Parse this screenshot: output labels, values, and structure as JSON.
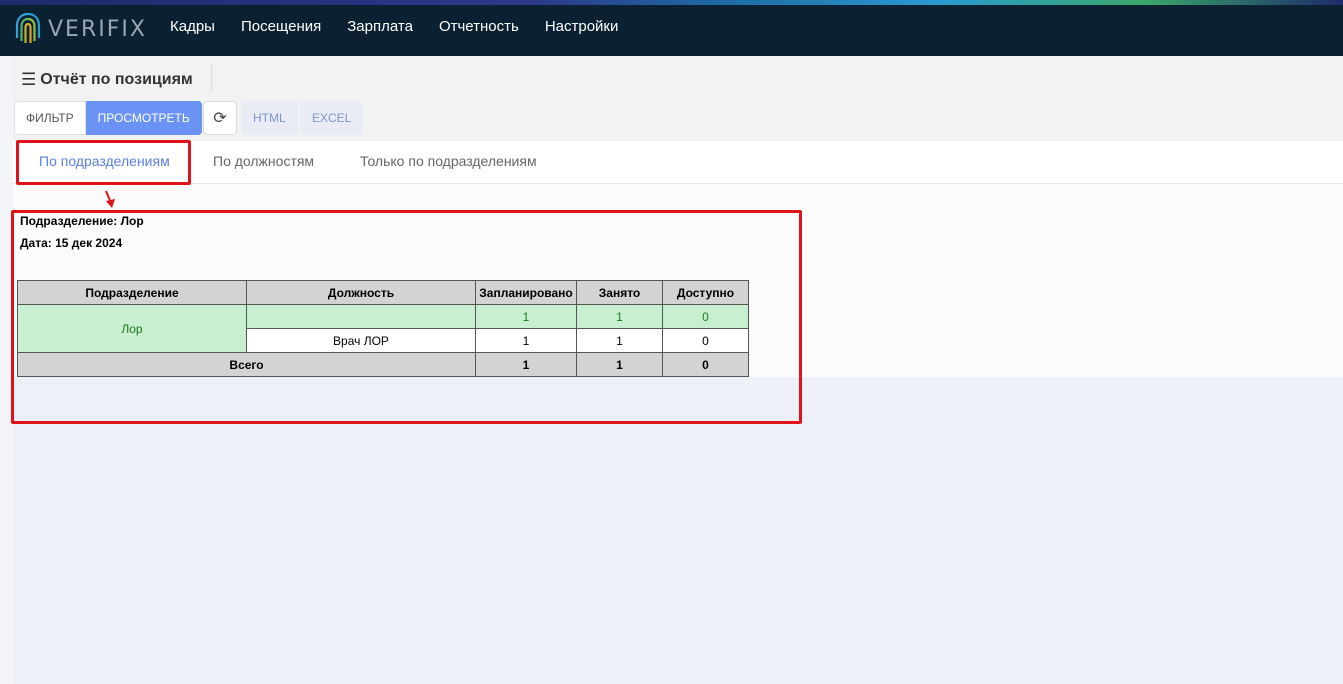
{
  "app": {
    "logo_text": "VERIFIX"
  },
  "nav": {
    "items": [
      "Кадры",
      "Посещения",
      "Зарплата",
      "Отчетность",
      "Настройки"
    ]
  },
  "page": {
    "title": "Отчёт по позициям"
  },
  "toolbar": {
    "filter_label": "ФИЛЬТР",
    "view_label": "ПРОСМОТРЕТЬ",
    "html_label": "HTML",
    "excel_label": "EXCEL"
  },
  "tabs": [
    {
      "label": "По подразделениям",
      "active": true
    },
    {
      "label": "По должностям",
      "active": false
    },
    {
      "label": "Только по подразделениям",
      "active": false
    }
  ],
  "report": {
    "department_line": "Подразделение: Лор",
    "date_line": "Дата: 15 дек 2024",
    "table": {
      "headers": [
        "Подразделение",
        "Должность",
        "Запланировано",
        "Занято",
        "Доступно"
      ],
      "group": {
        "department": "Лор",
        "summary": {
          "position": "",
          "planned": "1",
          "occupied": "1",
          "available": "0"
        },
        "rows": [
          {
            "position": "Врач ЛОР",
            "planned": "1",
            "occupied": "1",
            "available": "0"
          }
        ]
      },
      "total": {
        "label": "Всего",
        "planned": "1",
        "occupied": "1",
        "available": "0"
      }
    }
  },
  "colors": {
    "accent": "#6a93f5",
    "nav_bg": "#0b2030",
    "highlight_green": "#c8efd0",
    "annotation": "#e0131b"
  }
}
